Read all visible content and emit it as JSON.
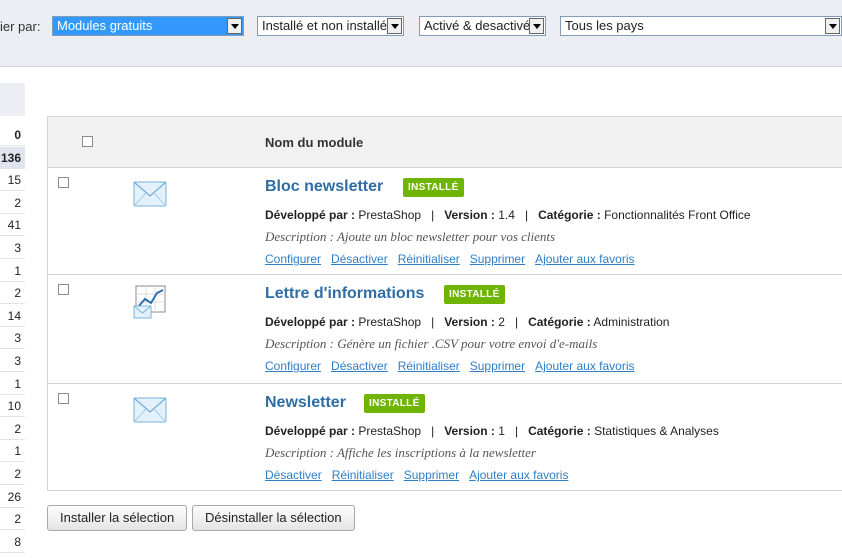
{
  "filters": {
    "label": "ier par:",
    "type": "Modules gratuits",
    "install_status": "Installé et non installé",
    "active_status": "Activé & desactivé",
    "country": "Tous les pays"
  },
  "counts": [
    "0",
    "136",
    "15",
    "2",
    "41",
    "3",
    "1",
    "2",
    "14",
    "3",
    "3",
    "1",
    "10",
    "2",
    "1",
    "2",
    "26",
    "2",
    "8"
  ],
  "table": {
    "header_title": "Nom du module"
  },
  "labels": {
    "developer": "Développé par :",
    "version": "Version :",
    "category": "Catégorie :",
    "desc_prefix": "Description :"
  },
  "modules": [
    {
      "name": "Bloc newsletter",
      "badge": "INSTALLÉ",
      "developer": "PrestaShop",
      "version": "1.4",
      "category": "Fonctionnalités Front Office",
      "description": "Ajoute un bloc newsletter pour vos clients",
      "actions": [
        "Configurer",
        "Désactiver",
        "Réinitialiser",
        "Supprimer",
        "Ajouter aux favoris"
      ],
      "icon": "envelope-icon"
    },
    {
      "name": "Lettre d'informations",
      "badge": "INSTALLÉ",
      "developer": "PrestaShop",
      "version": "2",
      "category": "Administration",
      "description": "Génère un fichier .CSV pour votre envoi d'e-mails",
      "actions": [
        "Configurer",
        "Désactiver",
        "Réinitialiser",
        "Supprimer",
        "Ajouter aux favoris"
      ],
      "icon": "chart-envelope-icon"
    },
    {
      "name": "Newsletter",
      "badge": "INSTALLÉ",
      "developer": "PrestaShop",
      "version": "1",
      "category": "Statistiques & Analyses",
      "description": "Affiche les inscriptions à la newsletter",
      "actions": [
        "Désactiver",
        "Réinitialiser",
        "Supprimer",
        "Ajouter aux favoris"
      ],
      "icon": "envelope-icon"
    }
  ],
  "buttons": {
    "install": "Installer la sélection",
    "uninstall": "Désinstaller la sélection"
  }
}
